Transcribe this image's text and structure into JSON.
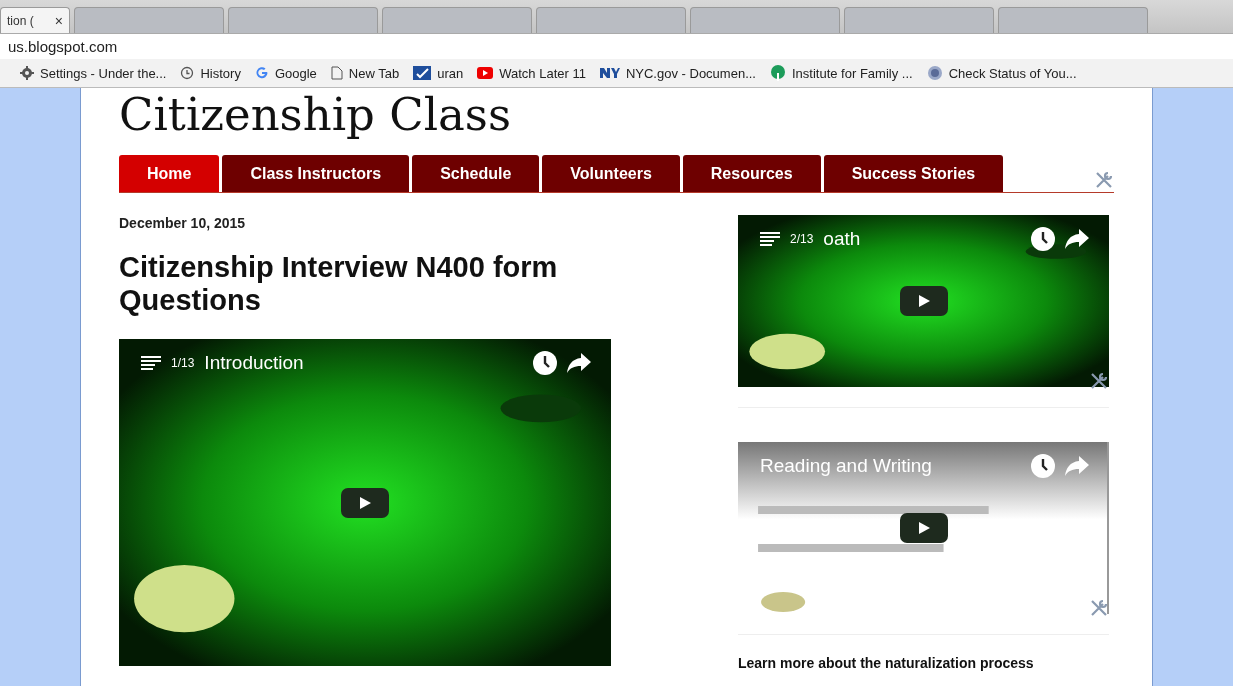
{
  "browser": {
    "tabs": [
      {
        "title": "tion (",
        "close": "×",
        "selected": true
      },
      {
        "selected": false
      },
      {
        "selected": false
      },
      {
        "selected": false
      },
      {
        "selected": false
      },
      {
        "selected": false
      },
      {
        "selected": false
      },
      {
        "selected": false
      }
    ],
    "address": "us.blogspot.com",
    "bookmarks": [
      {
        "kind": "settings",
        "label": "Settings - Under the..."
      },
      {
        "kind": "history",
        "label": "History"
      },
      {
        "kind": "google",
        "label": "Google"
      },
      {
        "kind": "page",
        "label": "New Tab"
      },
      {
        "kind": "uran",
        "label": "uran"
      },
      {
        "kind": "youtube",
        "label": "Watch Later 11"
      },
      {
        "kind": "nyc",
        "label": "NYC.gov - Documen..."
      },
      {
        "kind": "institute",
        "label": "Institute for Family ..."
      },
      {
        "kind": "status",
        "label": "Check Status of You..."
      }
    ]
  },
  "blog": {
    "title": "Citizenship Class",
    "nav": [
      {
        "label": "Home",
        "selected": true
      },
      {
        "label": "Class Instructors",
        "selected": false
      },
      {
        "label": "Schedule",
        "selected": false
      },
      {
        "label": "Volunteers",
        "selected": false
      },
      {
        "label": "Resources",
        "selected": false
      },
      {
        "label": "Success Stories",
        "selected": false
      }
    ]
  },
  "post": {
    "date": "December 10, 2015",
    "title": "Citizenship Interview N400 form Questions",
    "video": {
      "kind": "green",
      "index": "1/13",
      "title": "Introduction"
    }
  },
  "sidebar": {
    "videos": [
      {
        "kind": "green",
        "index": "2/13",
        "title": "oath"
      },
      {
        "kind": "white",
        "title": "Reading and Writing"
      }
    ],
    "heading": "Learn more about the naturalization process"
  }
}
